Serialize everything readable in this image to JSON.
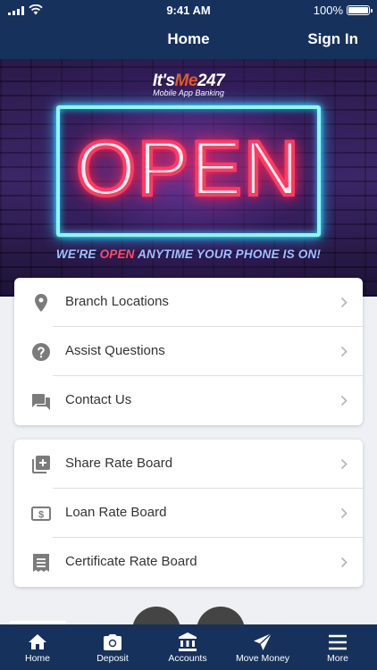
{
  "status_bar": {
    "time": "9:41 AM",
    "battery": "100%"
  },
  "nav": {
    "title": "Home",
    "sign_in": "Sign In"
  },
  "hero": {
    "logo_part1": "It's",
    "logo_part2": "Me",
    "logo_part3": "247",
    "logo_subtitle": "Mobile App Banking",
    "sign_text": "OPEN",
    "tagline_before": "WE'RE ",
    "tagline_open": "OPEN",
    "tagline_after": " ANYTIME YOUR PHONE IS ON!"
  },
  "menu_group1": {
    "items": [
      {
        "label": "Branch Locations",
        "icon": "location-pin-icon"
      },
      {
        "label": "Assist Questions",
        "icon": "help-icon"
      },
      {
        "label": "Contact Us",
        "icon": "chat-icon"
      }
    ]
  },
  "menu_group2": {
    "items": [
      {
        "label": "Share Rate Board",
        "icon": "add-library-icon"
      },
      {
        "label": "Loan Rate Board",
        "icon": "dollar-icon"
      },
      {
        "label": "Certificate Rate Board",
        "icon": "receipt-icon"
      }
    ]
  },
  "tabs": [
    {
      "label": "Home",
      "icon": "home-icon",
      "active": true
    },
    {
      "label": "Deposit",
      "icon": "camera-icon"
    },
    {
      "label": "Accounts",
      "icon": "bank-icon"
    },
    {
      "label": "Move Money",
      "icon": "send-icon"
    },
    {
      "label": "More",
      "icon": "menu-icon"
    }
  ],
  "colors": {
    "nav_background": "#16325c",
    "icon_gray": "#7b7b7b",
    "neon_red": "#ff3b63",
    "neon_blue": "#8ff6ff"
  }
}
